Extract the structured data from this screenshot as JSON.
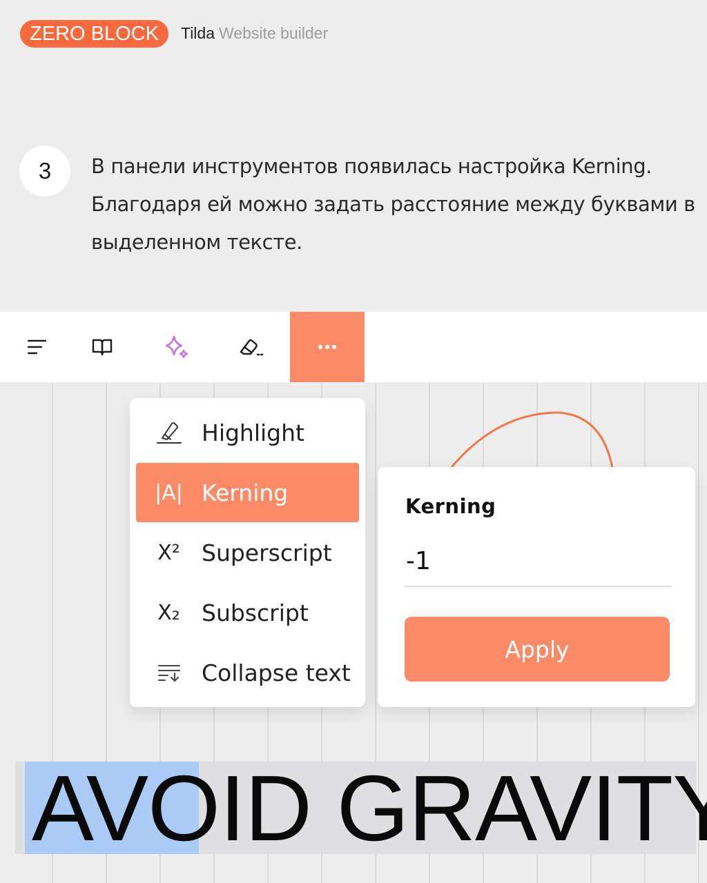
{
  "header": {
    "badge": "ZERO BLOCK",
    "brand_name": "Tilda",
    "brand_sub": "Website builder"
  },
  "step": {
    "number": "3",
    "text": "В панели инструментов появилась настройка Kerning. Благодаря ей можно задать расстояние между буквами в выделенном тексте."
  },
  "toolbar": {
    "items": [
      {
        "icon": "align-left-icon"
      },
      {
        "icon": "book-icon"
      },
      {
        "icon": "sparkle-icon"
      },
      {
        "icon": "eraser-icon"
      },
      {
        "icon": "more-icon",
        "active": true
      }
    ],
    "active_color": "#fa8b66",
    "sparkle_color": "#c76ae8"
  },
  "menu": {
    "items": [
      {
        "label": "Highlight",
        "icon": "highlighter-icon"
      },
      {
        "label": "Kerning",
        "icon": "kerning-icon",
        "icon_text": "|A|",
        "selected": true
      },
      {
        "label": "Superscript",
        "icon": "superscript-icon",
        "icon_text": "X²"
      },
      {
        "label": "Subscript",
        "icon": "subscript-icon",
        "icon_text": "X₂"
      },
      {
        "label": "Collapse text",
        "icon": "collapse-text-icon"
      }
    ]
  },
  "kerning_panel": {
    "title": "Kerning",
    "value": "-1",
    "apply_label": "Apply"
  },
  "sample": {
    "text": "AVOID GRAVITY",
    "selection_highlight_color": "#a9cbf6"
  },
  "colors": {
    "accent": "#f86a3e",
    "accent_soft": "#fa8b66",
    "background": "#ededee"
  }
}
